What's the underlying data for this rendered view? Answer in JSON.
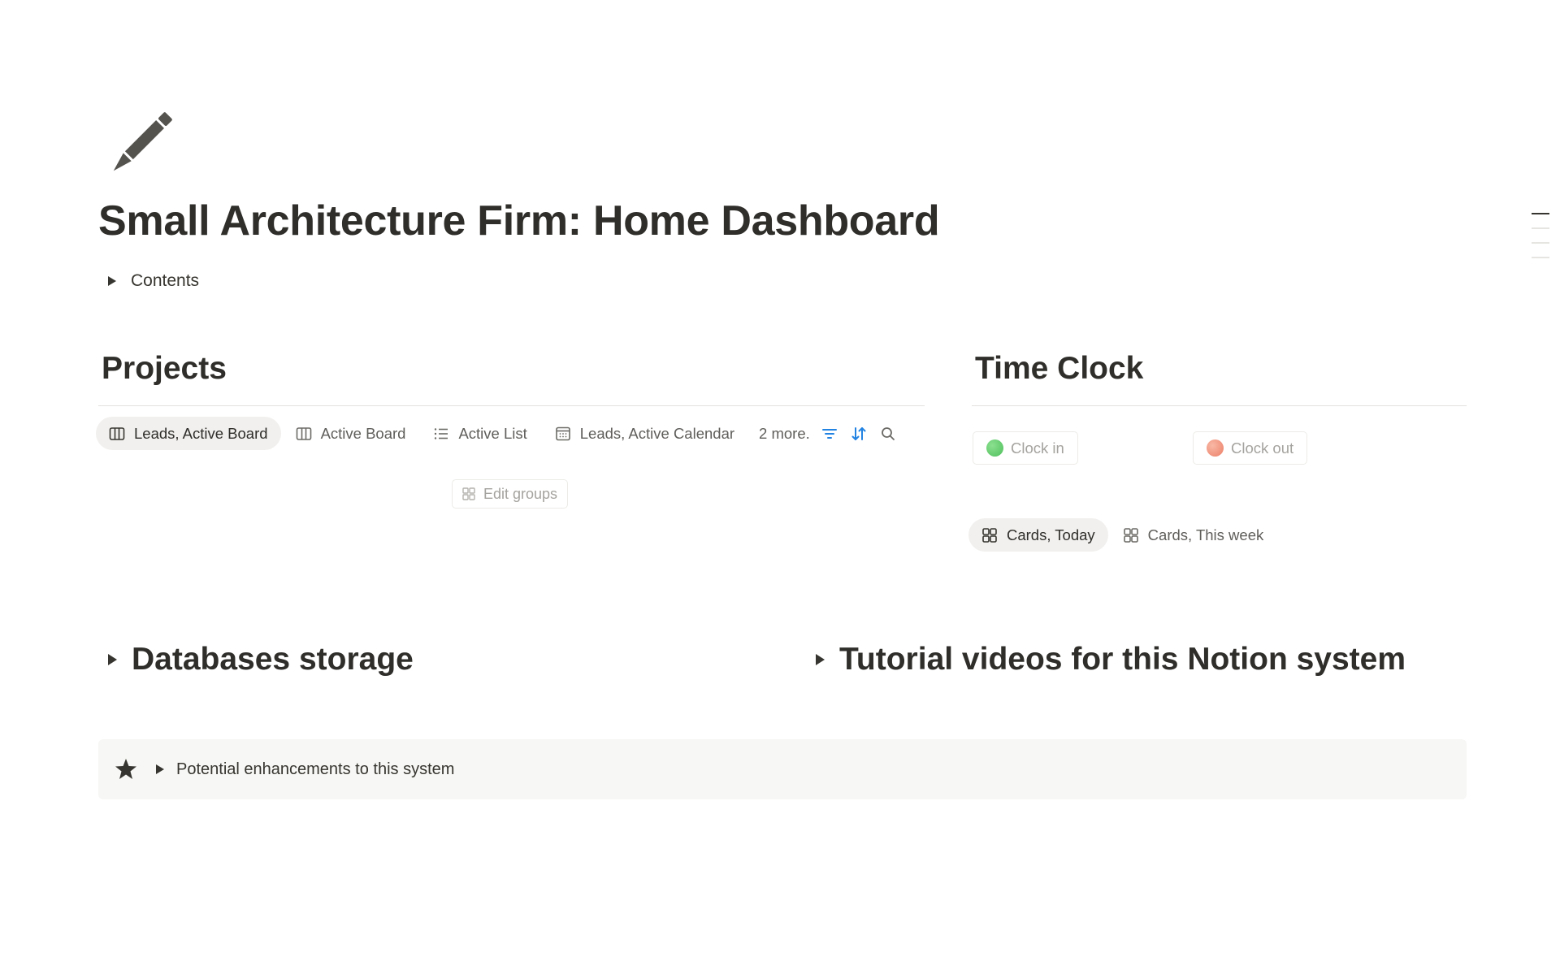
{
  "page": {
    "title": "Small Architecture Firm: Home Dashboard",
    "icon": "pencil-icon",
    "contents_toggle_label": "Contents"
  },
  "projects": {
    "heading": "Projects",
    "tabs": [
      {
        "label": "Leads, Active Board",
        "icon": "board-icon",
        "active": true
      },
      {
        "label": "Active Board",
        "icon": "board-icon",
        "active": false
      },
      {
        "label": "Active List",
        "icon": "list-icon",
        "active": false
      },
      {
        "label": "Leads, Active Calendar",
        "icon": "calendar-icon",
        "active": false
      }
    ],
    "more_label": "2 more.",
    "tools": [
      "filter-icon",
      "sort-icon",
      "search-icon"
    ],
    "edit_groups_label": "Edit groups"
  },
  "time_clock": {
    "heading": "Time Clock",
    "clock_in_label": "Clock in",
    "clock_out_label": "Clock out",
    "tabs": [
      {
        "label": "Cards, Today",
        "icon": "gallery-icon",
        "active": true
      },
      {
        "label": "Cards, This week",
        "icon": "gallery-icon",
        "active": false
      }
    ]
  },
  "toggles": {
    "databases_label": "Databases storage",
    "tutorials_label": "Tutorial videos for this Notion system"
  },
  "callout": {
    "icon": "star-icon",
    "label": "Potential enhancements to this system"
  },
  "colors": {
    "text": "#37352f",
    "accent_blue": "#2383e2",
    "clock_in_green": "#5bc46a",
    "clock_out_red": "#ef8a72",
    "callout_bg": "#f7f7f5"
  }
}
